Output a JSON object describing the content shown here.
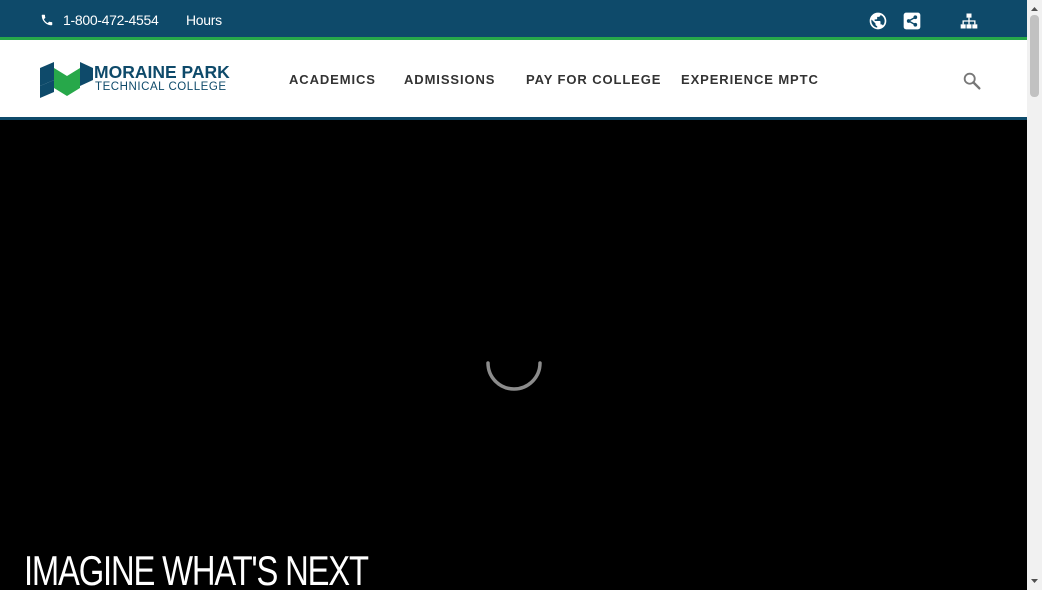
{
  "utility": {
    "phone": "1-800-472-4554",
    "hours": "Hours",
    "icons": [
      "globe-icon",
      "share-icon",
      "sitemap-icon"
    ]
  },
  "logo": {
    "title": "MORAINE PARK",
    "subtitle": "TECHNICAL COLLEGE"
  },
  "nav": {
    "items": [
      {
        "label": "ACADEMICS"
      },
      {
        "label": "ADMISSIONS"
      },
      {
        "label": "PAY FOR COLLEGE"
      },
      {
        "label": "EXPERIENCE MPTC"
      }
    ],
    "search_icon": "search-icon"
  },
  "hero": {
    "headline": "IMAGINE WHAT'S NEXT",
    "status": "loading-spinner"
  },
  "colors": {
    "brand_navy": "#0e4a6a",
    "brand_green": "#27a84a",
    "hero_bg": "#000000"
  }
}
